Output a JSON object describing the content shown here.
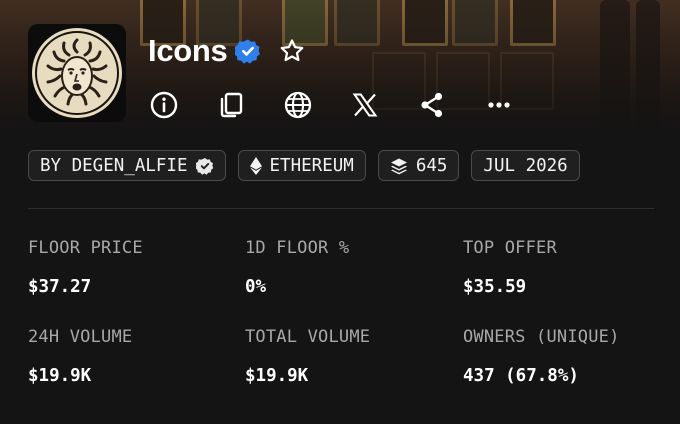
{
  "collection": {
    "name": "Icons",
    "verified": true
  },
  "icons": {
    "verified": "verified-badge-icon",
    "favorite": "star-icon",
    "actions": [
      "info-icon",
      "copy-icon",
      "globe-icon",
      "x-logo-icon",
      "share-icon",
      "more-icon"
    ]
  },
  "chips": {
    "creator": "BY DEGEN_ALFIE",
    "chain": "ETHEREUM",
    "items": "645",
    "date": "JUL 2026"
  },
  "stats": [
    {
      "label": "FLOOR PRICE",
      "value": "$37.27"
    },
    {
      "label": "1D FLOOR %",
      "value": "0%"
    },
    {
      "label": "TOP OFFER",
      "value": "$35.59"
    },
    {
      "label": "24H VOLUME",
      "value": "$19.9K"
    },
    {
      "label": "TOTAL VOLUME",
      "value": "$19.9K"
    },
    {
      "label": "OWNERS (UNIQUE)",
      "value": "437 (67.8%)"
    }
  ],
  "colors": {
    "background": "#141414",
    "verified_blue": "#2f80ed",
    "chip_border": "#4a4a4a",
    "label_gray": "#a8a8a8"
  }
}
